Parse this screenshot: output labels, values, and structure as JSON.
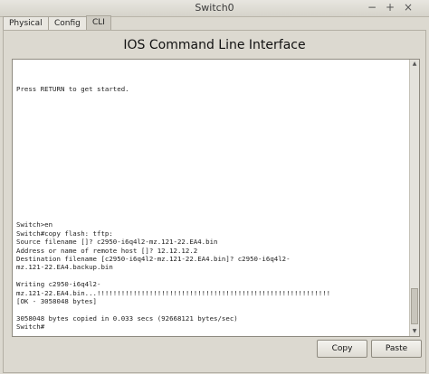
{
  "window": {
    "title": "Switch0",
    "minimize_label": "−",
    "maximize_label": "+",
    "close_label": "×"
  },
  "tabs": [
    {
      "label": "Physical"
    },
    {
      "label": "Config"
    },
    {
      "label": "CLI"
    }
  ],
  "panel": {
    "title": "IOS Command Line Interface"
  },
  "console": {
    "lines": [
      "",
      "",
      "",
      "Press RETURN to get started.",
      "",
      "",
      "",
      "",
      "",
      "",
      "",
      "",
      "",
      "",
      "",
      "",
      "",
      "",
      "",
      "Switch>en",
      "Switch#copy flash: tftp:",
      "Source filename []? c2950-i6q4l2-mz.121-22.EA4.bin",
      "Address or name of remote host []? 12.12.12.2",
      "Destination filename [c2950-i6q4l2-mz.121-22.EA4.bin]? c2950-i6q4l2-",
      "mz.121-22.EA4.backup.bin",
      "",
      "Writing c2950-i6q4l2-",
      "mz.121-22.EA4.bin...!!!!!!!!!!!!!!!!!!!!!!!!!!!!!!!!!!!!!!!!!!!!!!!!!!!!!!!!!!",
      "[OK - 3058048 bytes]",
      "",
      "3058048 bytes copied in 0.033 secs (92668121 bytes/sec)",
      "Switch#"
    ]
  },
  "buttons": {
    "copy_label": "Copy",
    "paste_label": "Paste"
  }
}
